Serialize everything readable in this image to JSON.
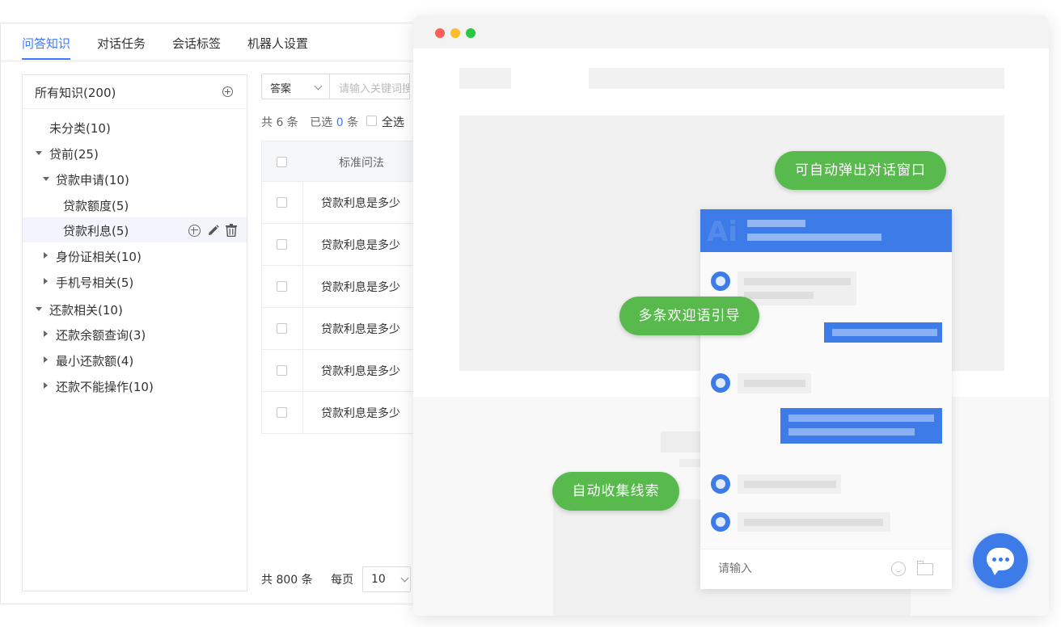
{
  "admin": {
    "tabs": [
      {
        "label": "问答知识",
        "active": true
      },
      {
        "label": "对话任务",
        "active": false
      },
      {
        "label": "会话标签",
        "active": false
      },
      {
        "label": "机器人设置",
        "active": false
      }
    ],
    "tree": {
      "root_label": "所有知识(200)",
      "items": [
        {
          "label": "未分类(10)",
          "level": 0,
          "toggle": "none"
        },
        {
          "label": "贷前(25)",
          "level": 0,
          "toggle": "expanded"
        },
        {
          "label": "贷款申请(10)",
          "level": 1,
          "toggle": "expanded"
        },
        {
          "label": "贷款额度(5)",
          "level": 2,
          "toggle": "none"
        },
        {
          "label": "贷款利息(5)",
          "level": 2,
          "toggle": "none",
          "selected": true
        },
        {
          "label": "身份证相关(10)",
          "level": 1,
          "toggle": "collapsed"
        },
        {
          "label": "手机号相关(5)",
          "level": 1,
          "toggle": "collapsed"
        },
        {
          "label": "还款相关(10)",
          "level": 0,
          "toggle": "expanded"
        },
        {
          "label": "还款余额查询(3)",
          "level": 1,
          "toggle": "collapsed"
        },
        {
          "label": "最小还款额(4)",
          "level": 1,
          "toggle": "collapsed"
        },
        {
          "label": "还款不能操作(10)",
          "level": 1,
          "toggle": "collapsed"
        }
      ]
    },
    "filter": {
      "select_value": "答案",
      "search_placeholder": "请输入关键词搜"
    },
    "summary": {
      "total_text": "共 6 条",
      "selected_prefix": "已选",
      "selected_count": "0",
      "selected_suffix": "条",
      "select_all": "全选"
    },
    "table": {
      "header": "标准问法",
      "rows": [
        "贷款利息是多少",
        "贷款利息是多少",
        "贷款利息是多少",
        "贷款利息是多少",
        "贷款利息是多少",
        "贷款利息是多少"
      ]
    },
    "pager": {
      "total_text": "共 800 条",
      "per_page_label": "每页",
      "per_page_value": "10"
    }
  },
  "browser": {
    "traffic_lights": [
      "#ff5f57",
      "#febc2e",
      "#28c840"
    ],
    "chat": {
      "input_placeholder": "请输入",
      "header_color": "#3d7be9"
    },
    "pills": {
      "popup": "可自动弹出对话窗口",
      "welcome": "多条欢迎语引导",
      "leads": "自动收集线索"
    },
    "pill_color": "#58b94d",
    "accent": "#3d7be9"
  }
}
